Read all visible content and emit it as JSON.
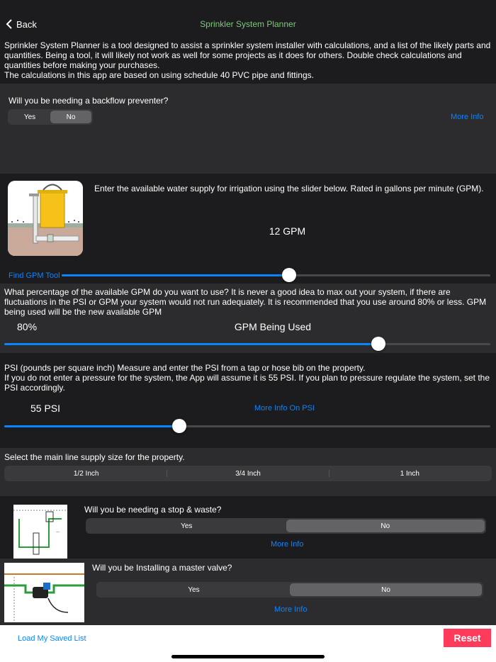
{
  "nav": {
    "back_label": "Back",
    "title": "Sprinkler System Planner"
  },
  "intro": {
    "paragraph": "Sprinkler System Planner is a tool designed to assist a sprinkler system installer with calculations, and a list of the likely parts and quantities.  Being a tool, it will likely not work as well for some projects as it does for others.  Double check calculations and quantities before making your purchases.",
    "note": "The calculations in this app are based on using schedule 40 PVC pipe and fittings."
  },
  "backflow": {
    "question": "Will you be needing a backflow preventer?",
    "options": [
      "Yes",
      "No"
    ],
    "selected": "No",
    "more_info": "More Info"
  },
  "gpm": {
    "instruction": "Enter the available water supply for irrigation using the slider below.  Rated in gallons per minute (GPM).",
    "value_label": "12 GPM",
    "tool_link": "Find GPM Tool",
    "slider_fraction": 0.53
  },
  "percentage": {
    "instruction": "What percentage of the available GPM do you want to use?  It is never a good idea to max out your system, if there are fluctuations in the PSI or GPM your system would not run adequately.  It is recommended that you use around 80% or less.  GPM being used will be the new available GPM",
    "percent_label": "80%",
    "gpm_used_label": "GPM Being Used",
    "slider_fraction": 0.77
  },
  "psi": {
    "instruction_1": "PSI (pounds per square inch) Measure and enter the PSI from a tap or hose bib on the property.",
    "instruction_2": "If you do not enter a pressure for the system, the App will assume it is 55 PSI.  If you plan to pressure regulate the system, set the PSI accordingly.",
    "value_label": "55 PSI",
    "more_info": "More Info On PSI",
    "slider_fraction": 0.36
  },
  "mainline": {
    "question": "Select the main line supply size for the property.",
    "options": [
      "1/2 Inch",
      "3/4 Inch",
      "1 Inch"
    ]
  },
  "stopwaste": {
    "question": "Will you be needing a stop & waste?",
    "options": [
      "Yes",
      "No"
    ],
    "selected": "No",
    "more_info": "More Info"
  },
  "mastervalve": {
    "question": "Will you be Installing a master valve?",
    "options": [
      "Yes",
      "No"
    ],
    "selected": "No",
    "more_info": "More Info"
  },
  "footer": {
    "load_label": "Load My Saved List",
    "reset_label": "Reset"
  },
  "colors": {
    "accent": "#0a84ff",
    "title_green": "#7dc97b",
    "reset": "#ff3b5c"
  }
}
